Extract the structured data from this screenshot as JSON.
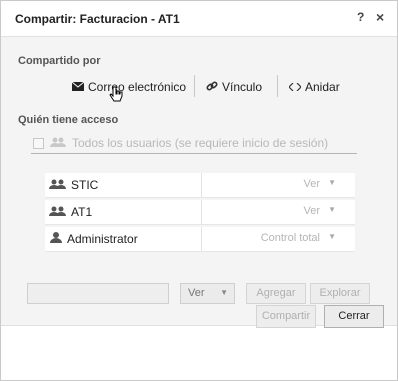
{
  "dialog": {
    "title": "Compartir: Facturacion - AT1",
    "help_label": "?",
    "close_label": "×"
  },
  "shared_by": {
    "label": "Compartido por",
    "options": [
      {
        "label": "Correo electrónico",
        "icon": "envelope-icon"
      },
      {
        "label": "Vínculo",
        "icon": "link-icon"
      },
      {
        "label": "Anidar",
        "icon": "embed-icon"
      }
    ]
  },
  "access": {
    "label": "Quién tiene acceso",
    "everyone_label": "Todos los usuarios (se requiere inicio de sesión)",
    "rows": [
      {
        "name": "STIC",
        "icon": "group-icon",
        "permission": "Ver"
      },
      {
        "name": "AT1",
        "icon": "group-icon",
        "permission": "Ver"
      },
      {
        "name": "Administrator",
        "icon": "user-icon",
        "permission": "Control total"
      }
    ]
  },
  "add": {
    "permission_value": "Ver",
    "add_label": "Agregar",
    "browse_label": "Explorar"
  },
  "footer": {
    "share_label": "Compartir",
    "close_label": "Cerrar"
  },
  "colors": {
    "body_bg": "#f4f4f4",
    "disabled_text": "#b0b0b0"
  }
}
